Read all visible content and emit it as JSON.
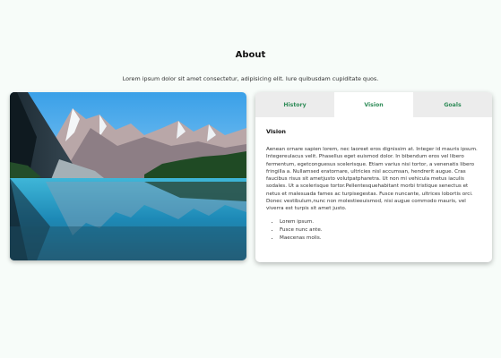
{
  "header": {
    "title": "About",
    "subtitle": "Lorem ipsum dolor sit amet consectetur, adipisicing elit. Iure quibusdam cupiditate quos."
  },
  "image": {
    "description_icon": "mountain-lake-photo"
  },
  "tabs": [
    {
      "label": "History",
      "active": false
    },
    {
      "label": "Vision",
      "active": true
    },
    {
      "label": "Goals",
      "active": false
    }
  ],
  "panel": {
    "heading": "Vision",
    "body": "Aenean ornare sapien lorem, nec laoreet eros dignissim at. Integer id mauris ipsum. Integereulacus velit. Phasellus eget euismod dolor. In bibendum eros vel libero fermentum, egetconguesus scelerisque. Etiam varius nisi tortor, a venenatis libero fringilla a. Nullamsed eratornare, ultricies nisl accumsan, hendrerit augue. Cras faucibus risus sit ametjusto volutpatpharetra. Ut non mi vehicula metus iaculis sodales. Ut a scelerisque tortor.Pellentesquehabitant morbi tristique senectus et netus et malesuada fames ac turpisegestas. Fusce nuncante, ultrices lobortis orci. Donec vestibulum,nunc non molestieeuismod, nisi augue commodo mauris, vel viverra est turpis sit amet justo.",
    "list": [
      "Lorem ipsum.",
      "Fusce nunc ante.",
      "Maecenas molis."
    ]
  },
  "colors": {
    "accent": "#2e8b57",
    "background": "#f7fcf9",
    "tab_inactive": "#ececec"
  }
}
